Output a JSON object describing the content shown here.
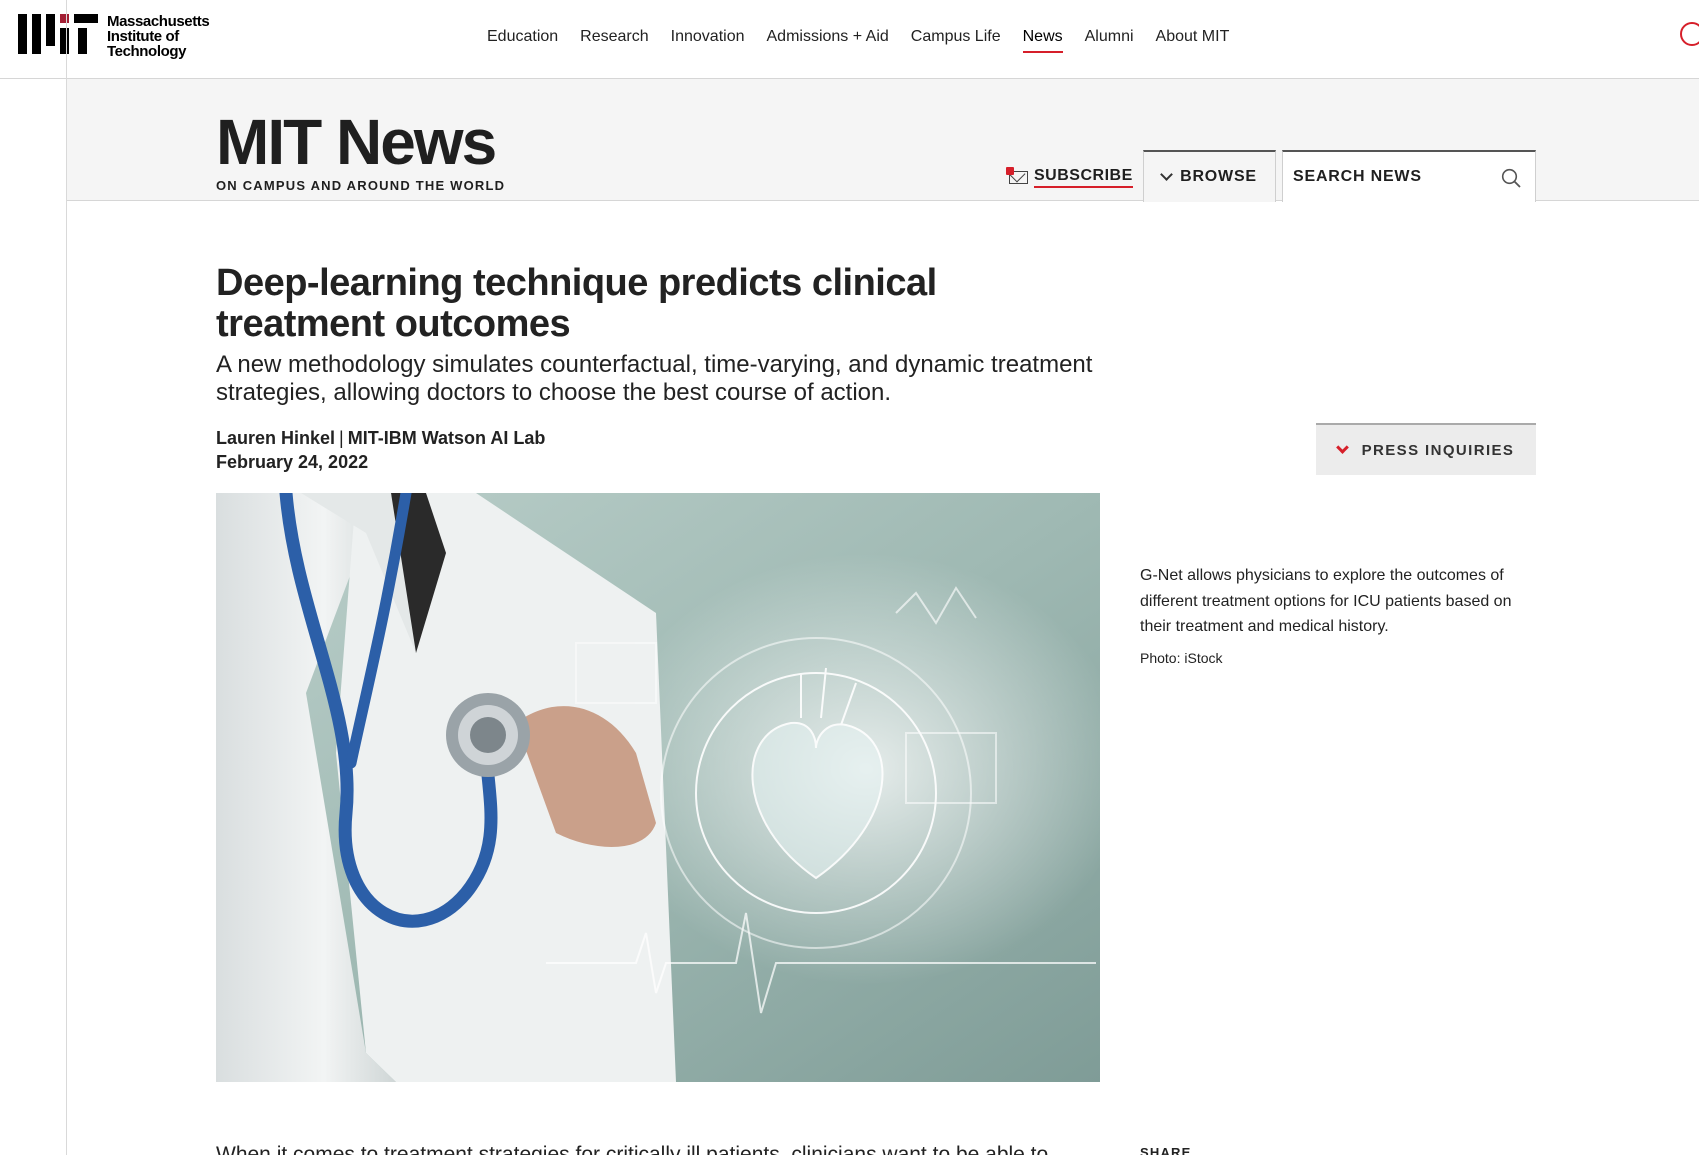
{
  "institution": {
    "wordmark": [
      "Massachusetts",
      "Institute of",
      "Technology"
    ]
  },
  "topnav": {
    "items": [
      {
        "label": "Education",
        "active": false
      },
      {
        "label": "Research",
        "active": false
      },
      {
        "label": "Innovation",
        "active": false
      },
      {
        "label": "Admissions + Aid",
        "active": false
      },
      {
        "label": "Campus Life",
        "active": false
      },
      {
        "label": "News",
        "active": true
      },
      {
        "label": "Alumni",
        "active": false
      },
      {
        "label": "About MIT",
        "active": false
      }
    ]
  },
  "news_header": {
    "title": "MIT News",
    "tagline": "ON CAMPUS AND AROUND THE WORLD",
    "subscribe_label": "SUBSCRIBE",
    "browse_label": "BROWSE",
    "search_placeholder": "SEARCH NEWS"
  },
  "article": {
    "title": "Deep-learning technique predicts clinical treatment outcomes",
    "subtitle": "A new methodology simulates counterfactual, time-varying, and dynamic treatment strategies, allowing doctors to choose the best course of action.",
    "author": "Lauren Hinkel",
    "affiliation": "MIT-IBM Watson AI Lab",
    "date": "February 24, 2022",
    "press_label": "PRESS INQUIRIES",
    "image_caption": "G-Net allows physicians to explore the outcomes of different treatment options for ICU patients based on their treatment and medical history.",
    "image_credit": "Photo: iStock",
    "body_first_line": "When it comes to treatment strategies for critically ill patients, clinicians want to be able to",
    "share_label": "SHARE"
  },
  "colors": {
    "accent": "#d61f2a",
    "header_band": "#f5f5f5",
    "text": "#222222"
  },
  "icons": [
    "mit-logo-icon",
    "search-icon",
    "mail-icon",
    "chevron-down-icon"
  ]
}
